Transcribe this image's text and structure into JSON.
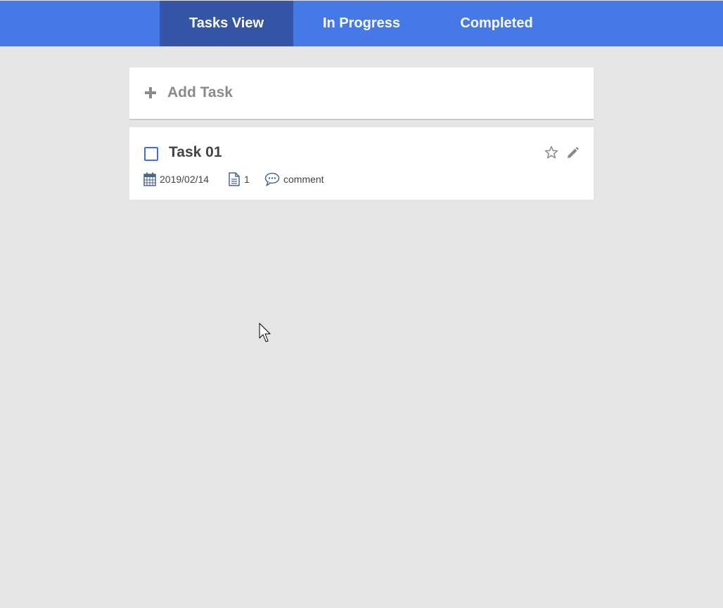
{
  "nav": {
    "tabs": [
      {
        "label": "Tasks View",
        "active": true
      },
      {
        "label": "In Progress",
        "active": false
      },
      {
        "label": "Completed",
        "active": false
      }
    ]
  },
  "add_task": {
    "label": "Add Task",
    "icon": "plus-icon"
  },
  "task": {
    "title": "Task 01",
    "checked": false,
    "starred": false,
    "date": "2019/02/14",
    "files": "1",
    "comment_label": "comment",
    "icons": [
      "checkbox",
      "star-icon",
      "pencil-icon",
      "calendar-icon",
      "file-icon",
      "comment-icon"
    ]
  },
  "colors": {
    "header": "#4579e8",
    "active_tab": "#3555a6",
    "background": "#e5e5e5",
    "card": "#ffffff",
    "checkbox_border": "#3f6fd8",
    "meta_icon": "#4a6785"
  }
}
